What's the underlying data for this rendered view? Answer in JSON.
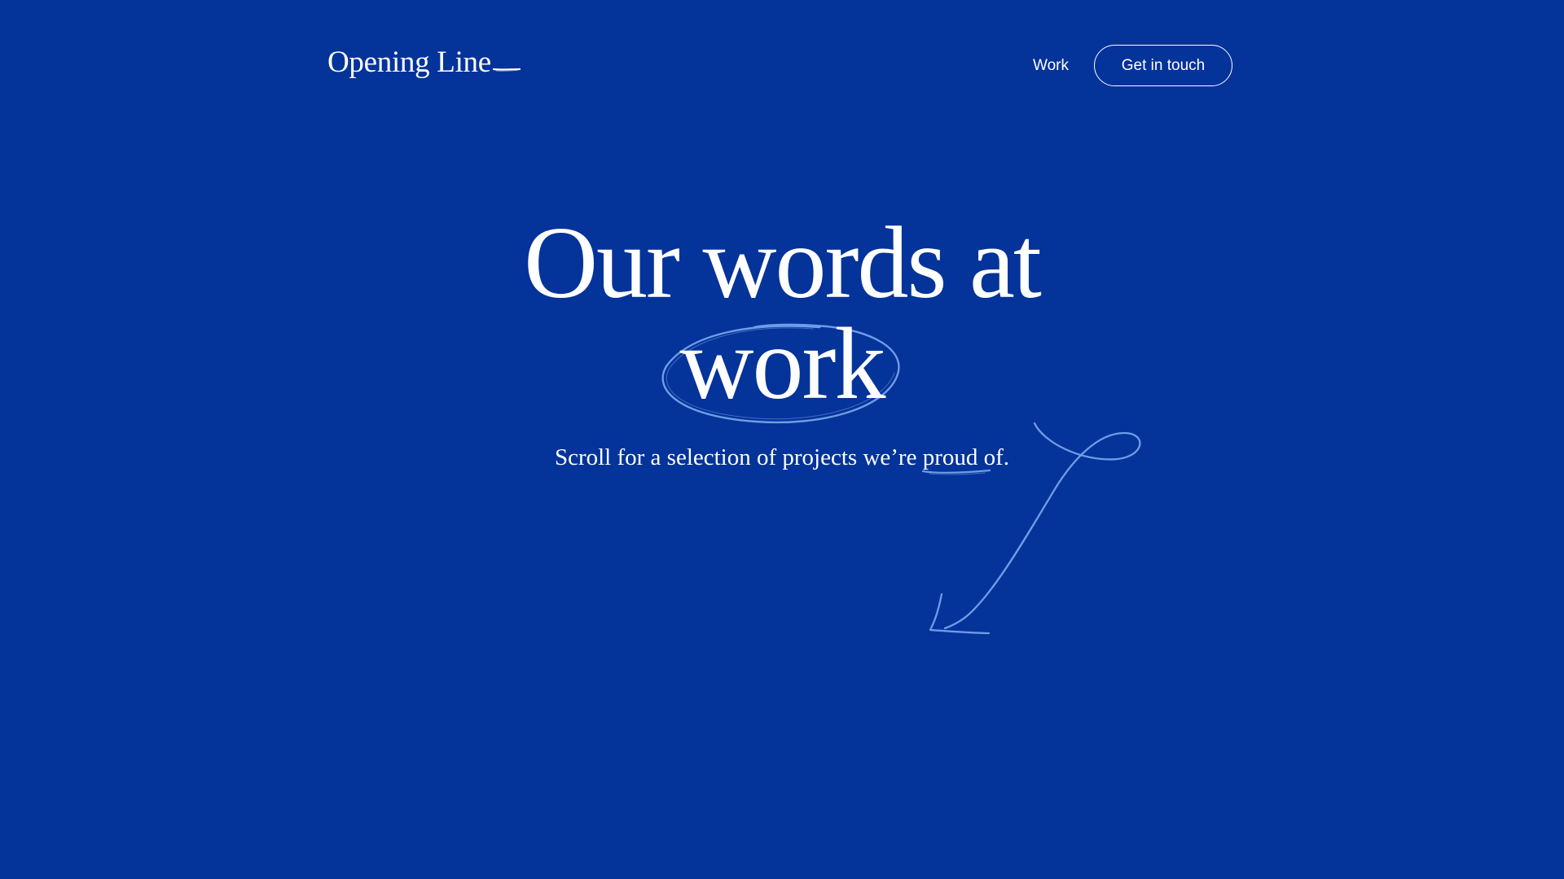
{
  "header": {
    "logo_text": "Opening Line",
    "nav_work_label": "Work",
    "contact_button_label": "Get in touch"
  },
  "hero": {
    "title_line_1": "Our words at",
    "title_line_2": "work",
    "subtitle_before": "Scroll for a selection of projects we’re ",
    "subtitle_highlight": "proud",
    "subtitle_after": " of."
  },
  "colors": {
    "background": "#04339a",
    "text": "#ffffff",
    "doodle": "#6f9ce6"
  },
  "icons": {
    "circle": "hand-drawn-circle-icon",
    "underline": "hand-drawn-underline-icon",
    "arrow": "hand-drawn-arrow-icon"
  }
}
